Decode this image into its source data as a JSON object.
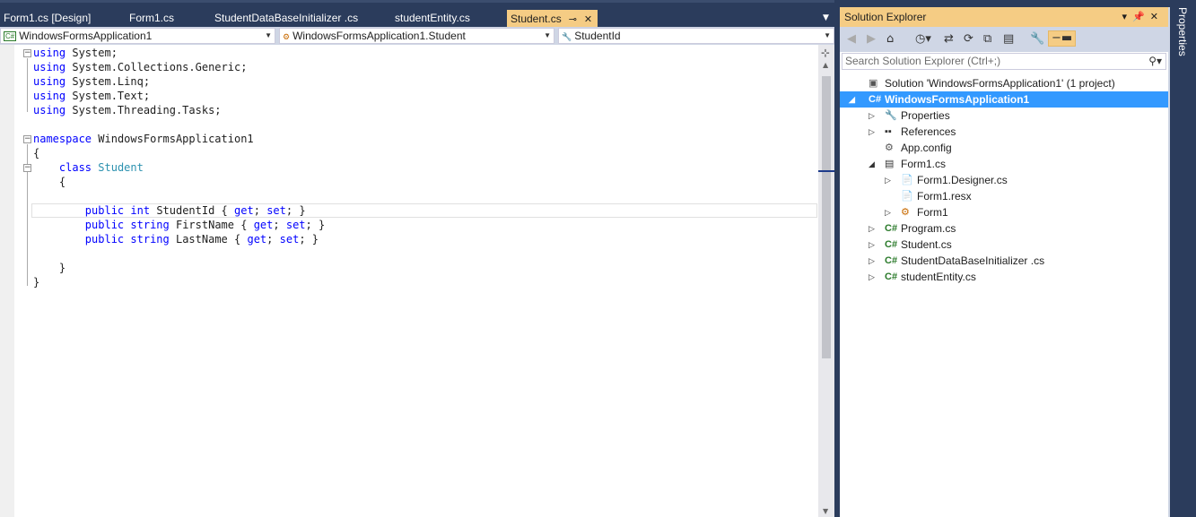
{
  "tabs": [
    {
      "label": "Form1.cs [Design]"
    },
    {
      "label": "Form1.cs"
    },
    {
      "label": "StudentDataBaseInitializer .cs"
    },
    {
      "label": "studentEntity.cs"
    },
    {
      "label": "Student.cs",
      "active": true
    }
  ],
  "navbar": {
    "project": "WindowsFormsApplication1",
    "class": "WindowsFormsApplication1.Student",
    "member": "StudentId"
  },
  "code": {
    "lines": [
      {
        "parts": [
          [
            "kw",
            "using"
          ],
          [
            "",
            "System;"
          ]
        ]
      },
      {
        "parts": [
          [
            "kw",
            "using"
          ],
          [
            "",
            "System.Collections.Generic;"
          ]
        ]
      },
      {
        "parts": [
          [
            "kw",
            "using"
          ],
          [
            "",
            "System.Linq;"
          ]
        ]
      },
      {
        "parts": [
          [
            "kw",
            "using"
          ],
          [
            "",
            "System.Text;"
          ]
        ]
      },
      {
        "parts": [
          [
            "kw",
            "using"
          ],
          [
            "",
            "System.Threading.Tasks;"
          ]
        ]
      },
      {
        "parts": []
      },
      {
        "parts": [
          [
            "kw",
            "namespace"
          ],
          [
            "",
            "WindowsFormsApplication1"
          ]
        ]
      },
      {
        "parts": [
          [
            "",
            "{"
          ]
        ]
      },
      {
        "parts": [
          [
            "",
            "    "
          ],
          [
            "kw",
            "class"
          ],
          [
            "ty",
            "Student"
          ]
        ]
      },
      {
        "parts": [
          [
            "",
            "    {"
          ]
        ]
      },
      {
        "parts": []
      },
      {
        "parts": [
          [
            "",
            "        "
          ],
          [
            "kw",
            "public"
          ],
          [
            "kw",
            "int"
          ],
          [
            "",
            "StudentId {"
          ],
          [
            "kw",
            "get"
          ],
          [
            "",
            ";"
          ],
          [
            "kw",
            "set"
          ],
          [
            "",
            "; }"
          ]
        ]
      },
      {
        "parts": [
          [
            "",
            "        "
          ],
          [
            "kw",
            "public"
          ],
          [
            "kw",
            "string"
          ],
          [
            "",
            "FirstName {"
          ],
          [
            "kw",
            "get"
          ],
          [
            "",
            ";"
          ],
          [
            "kw",
            "set"
          ],
          [
            "",
            "; }"
          ]
        ]
      },
      {
        "parts": [
          [
            "",
            "        "
          ],
          [
            "kw",
            "public"
          ],
          [
            "kw",
            "string"
          ],
          [
            "",
            "LastName {"
          ],
          [
            "kw",
            "get"
          ],
          [
            "",
            ";"
          ],
          [
            "kw",
            "set"
          ],
          [
            "",
            "; }"
          ]
        ]
      },
      {
        "parts": []
      },
      {
        "parts": [
          [
            "",
            "    }"
          ]
        ]
      },
      {
        "parts": [
          [
            "",
            "}"
          ]
        ]
      }
    ]
  },
  "solution_explorer": {
    "title": "Solution Explorer",
    "search_placeholder": "Search Solution Explorer (Ctrl+;)",
    "items": [
      {
        "label": "Solution 'WindowsFormsApplication1' (1 project)",
        "icon": "solution-icon",
        "expander": "",
        "level": 0
      },
      {
        "label": "WindowsFormsApplication1",
        "icon": "csharp-project-icon",
        "expander": "expanded",
        "level": 0,
        "selected": true
      },
      {
        "label": "Properties",
        "icon": "wrench-icon",
        "expander": "collapsed",
        "level": 1
      },
      {
        "label": "References",
        "icon": "references-icon",
        "expander": "collapsed",
        "level": 1
      },
      {
        "label": "App.config",
        "icon": "config-file-icon",
        "expander": "",
        "level": 1
      },
      {
        "label": "Form1.cs",
        "icon": "form-icon",
        "expander": "expanded",
        "level": 1
      },
      {
        "label": "Form1.Designer.cs",
        "icon": "code-file-icon",
        "expander": "collapsed",
        "level": 2
      },
      {
        "label": "Form1.resx",
        "icon": "resource-file-icon",
        "expander": "",
        "level": 2
      },
      {
        "label": "Form1",
        "icon": "class-icon",
        "expander": "collapsed",
        "level": 2
      },
      {
        "label": "Program.cs",
        "icon": "csharp-file-icon",
        "expander": "collapsed",
        "level": 1
      },
      {
        "label": "Student.cs",
        "icon": "csharp-file-icon",
        "expander": "collapsed",
        "level": 1
      },
      {
        "label": "StudentDataBaseInitializer .cs",
        "icon": "csharp-file-icon",
        "expander": "collapsed",
        "level": 1
      },
      {
        "label": "studentEntity.cs",
        "icon": "csharp-file-icon",
        "expander": "collapsed",
        "level": 1
      }
    ]
  },
  "right_tab": {
    "label": "Properties"
  },
  "colors": {
    "active_tab": "#f5cc84",
    "selection": "#3399ff",
    "keyword": "#0000ff",
    "type": "#2b91af",
    "chrome": "#2b3c5c"
  }
}
